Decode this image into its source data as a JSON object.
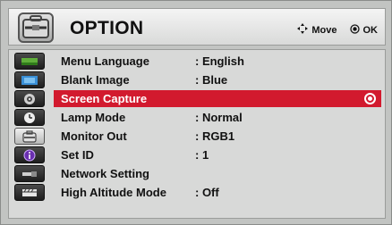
{
  "header": {
    "title": "OPTION",
    "move_hint": "Move",
    "ok_hint": "OK",
    "move_icon": "dpad-arrows-icon",
    "ok_icon": "ok-button-icon"
  },
  "sidebar": {
    "items": [
      {
        "icon": "picture-icon",
        "active": false
      },
      {
        "icon": "screen-icon",
        "active": false
      },
      {
        "icon": "audio-icon",
        "active": false
      },
      {
        "icon": "time-icon",
        "active": false
      },
      {
        "icon": "option-toolbox-icon",
        "active": true
      },
      {
        "icon": "info-icon",
        "active": false
      },
      {
        "icon": "input-connector-icon",
        "active": false
      },
      {
        "icon": "3d-glasses-icon",
        "active": false
      }
    ]
  },
  "menu": {
    "items": [
      {
        "label": "Menu Language",
        "value": ": English",
        "selected": false
      },
      {
        "label": "Blank Image",
        "value": ": Blue",
        "selected": false
      },
      {
        "label": "Screen Capture",
        "value": "",
        "selected": true
      },
      {
        "label": "Lamp Mode",
        "value": ": Normal",
        "selected": false
      },
      {
        "label": "Monitor Out",
        "value": ": RGB1",
        "selected": false
      },
      {
        "label": "Set ID",
        "value": ": 1",
        "selected": false
      },
      {
        "label": "Network Setting",
        "value": "",
        "selected": false
      },
      {
        "label": "High Altitude Mode",
        "value": ": Off",
        "selected": false
      }
    ]
  },
  "colors": {
    "selection": "#d21a2e",
    "panel": "#d8d9d8",
    "frame": "#c2c4c2"
  }
}
